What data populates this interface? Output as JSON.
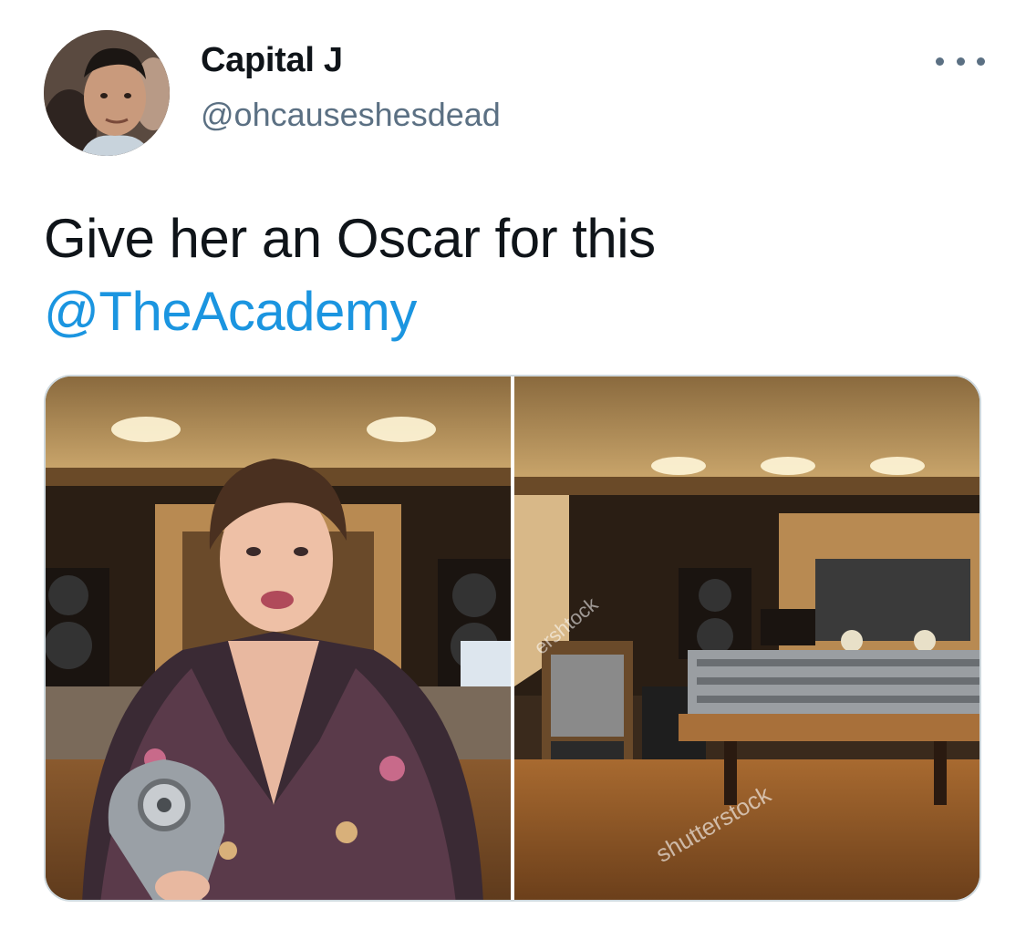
{
  "tweet": {
    "author": {
      "display_name": "Capital J",
      "handle": "@ohcauseshesdead"
    },
    "text_line1": "Give her an Oscar for this",
    "mention": "@TheAcademy",
    "more_icon": "more-dots-icon",
    "media": [
      {
        "kind": "photo",
        "subject": "woman-holding-award-in-studio"
      },
      {
        "kind": "photo",
        "subject": "recording-studio-stock-photo",
        "watermark": "shutterstock"
      }
    ]
  },
  "colors": {
    "text": "#0f1419",
    "secondary": "#5b7083",
    "link": "#1b95e0",
    "border": "#cfd9de"
  }
}
